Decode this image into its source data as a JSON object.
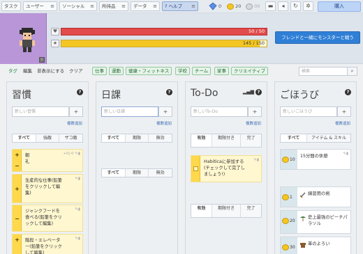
{
  "nav": {
    "task": "タスク",
    "user": "ユーザー",
    "social": "ソーシャル",
    "inventory": "所持品",
    "data": "データ",
    "help": "ヘルプ",
    "gems": "0",
    "gold": "20",
    "silver": "00",
    "buy": "購入"
  },
  "header": {
    "hp": "50 / 50",
    "exp": "145 / 150",
    "exp_fraction": 0.967,
    "party_button": "フレンドと一緒にモンスターと戦う"
  },
  "filters": {
    "tags_label": "タグ",
    "edit": "編集",
    "hide": "非表示にする",
    "clear": "クリア",
    "tags": [
      "仕事",
      "運動",
      "健康・フィットネス",
      "学校",
      "チーム",
      "家事",
      "クリエイティブ"
    ],
    "search_placeholder": "検索"
  },
  "habits": {
    "title": "習慣",
    "placeholder": "新しい習慣",
    "advanced": "複数追加",
    "tabs": [
      "すべて",
      "強敵",
      "ザコ敵"
    ],
    "items": [
      {
        "text": "朝\n礼",
        "meta": "+0|-0"
      },
      {
        "text": "生産的な仕事(鉛筆をクリックして編集)",
        "meta": ""
      },
      {
        "text": "ジャンクフードを食べる(鉛筆をクリックして編集)",
        "meta": ""
      },
      {
        "text": "階段・エレベーター(鉛筆をクリックして編集)",
        "meta": ""
      }
    ]
  },
  "dailies": {
    "title": "日課",
    "placeholder": "新しい日課",
    "advanced": "複数追加",
    "tabs": [
      "すべて",
      "期限",
      "無効"
    ],
    "tabs2": [
      "すべて",
      "期限",
      "無効"
    ]
  },
  "todos": {
    "title": "To-Do",
    "placeholder": "新しいTo-Do",
    "advanced": "複数追加",
    "tabs": [
      "有効",
      "期限付き",
      "完了"
    ],
    "item": "Habiticaに参加する(チェックして完了しましょう!)",
    "tabs2": [
      "有効",
      "期限付き",
      "完了"
    ]
  },
  "rewards": {
    "title": "ごほうび",
    "placeholder": "新しいごほうび",
    "advanced": "複数追加",
    "tabs": [
      "すべて",
      "アイテム & スキル"
    ],
    "custom": {
      "price": "10",
      "name": "15分間の休憩"
    },
    "items": [
      {
        "price": "1",
        "name": "練習用の剣"
      },
      {
        "price": "20",
        "name": "史上最強のピーチパラソル"
      },
      {
        "price": "30",
        "name": "革のよろい"
      }
    ]
  },
  "colors": {
    "accent": "#2f7fd6",
    "hp": "#e24b4b",
    "exp": "#f4c623",
    "habit_yellow": "#ffd84c"
  }
}
